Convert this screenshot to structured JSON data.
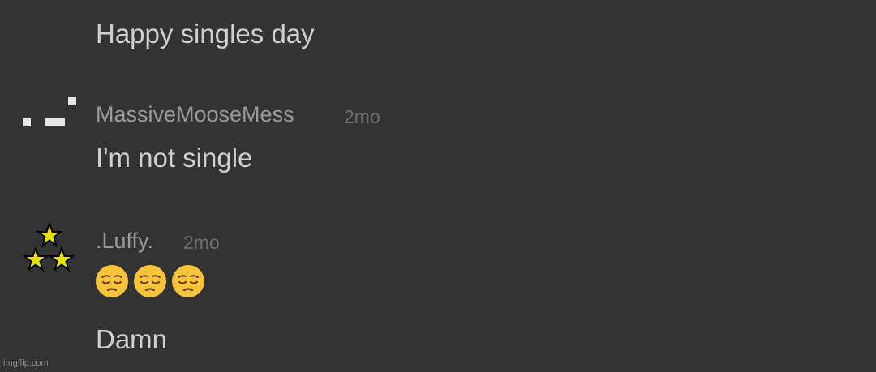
{
  "thread": {
    "root_message": "Happy singles day",
    "comments": [
      {
        "username": "MassiveMooseMess",
        "timestamp": "2mo",
        "avatar_icon": "pixel-blocks-icon",
        "text": "I'm not single"
      },
      {
        "username": ".Luffy.",
        "timestamp": "2mo",
        "avatar_icon": "stars-icon",
        "emojis": [
          "pensive-face",
          "pensive-face",
          "pensive-face"
        ],
        "text": "Damn"
      }
    ]
  },
  "watermark": "imgflip.com",
  "colors": {
    "background": "#333333",
    "text": "#d0d0d0",
    "username": "#9a9a9a",
    "timestamp": "#6f6f6f",
    "emoji_face": "#f6c33a",
    "star_fill": "#e8e000"
  }
}
